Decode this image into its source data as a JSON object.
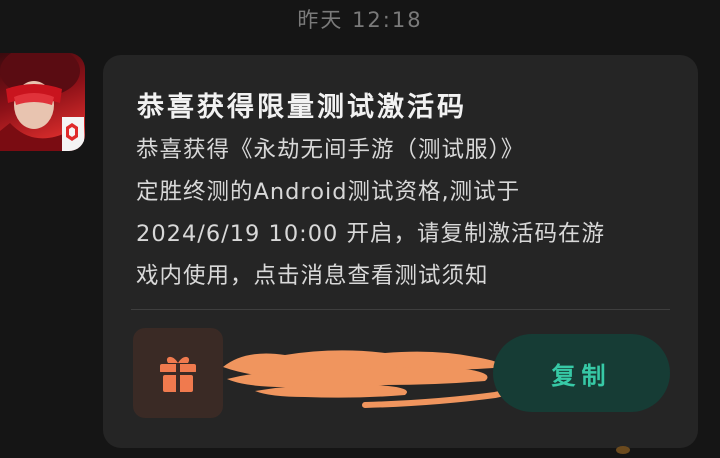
{
  "timestamp": "昨天 12:18",
  "message": {
    "title": "恭喜获得限量测试激活码",
    "body_lines": [
      "恭喜获得《永劫无间手游（测试服）》",
      "定胜终测的Android测试资格,测试于",
      "2024/6/19 10:00 开启，请复制激活码在游",
      "戏内使用，点击消息查看测试须知"
    ]
  },
  "actions": {
    "copy_label": "复制"
  },
  "icons": {
    "avatar": "game-app-avatar-icon",
    "gift": "gift-icon"
  },
  "colors": {
    "background": "#151515",
    "card": "#252525",
    "gift_tile": "#3a2a25",
    "gift": "#f07a4e",
    "redaction": "#f0955e",
    "copy_button_bg": "#163c35",
    "copy_button_text": "#37c9a6"
  }
}
